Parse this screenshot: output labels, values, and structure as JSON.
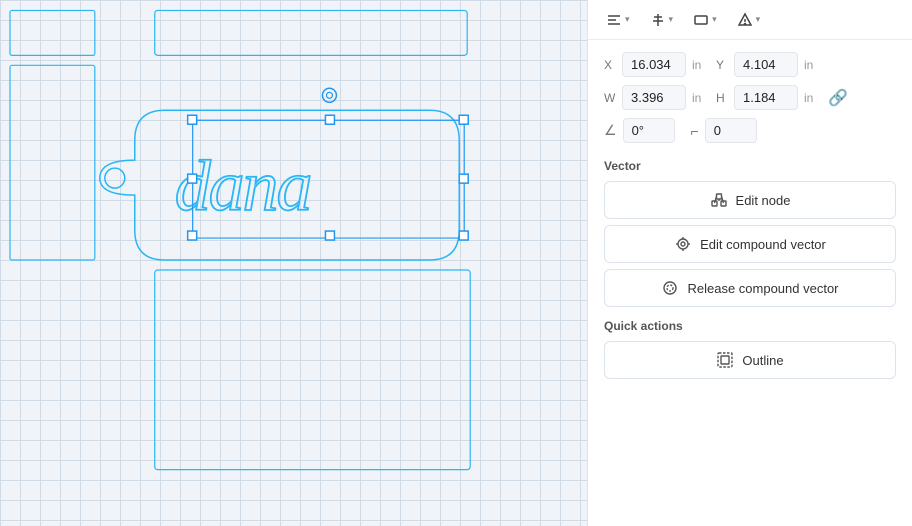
{
  "toolbar": {
    "btn1_label": "≡",
    "btn2_label": "≡",
    "btn3_label": "▦",
    "btn4_label": "⚠"
  },
  "properties": {
    "x_label": "X",
    "y_label": "Y",
    "w_label": "W",
    "h_label": "H",
    "x_value": "16.034",
    "y_value": "4.104",
    "w_value": "3.396",
    "h_value": "1.184",
    "unit": "in",
    "angle_value": "0°",
    "corner_value": "0"
  },
  "vector_section": {
    "label": "Vector",
    "edit_node_label": "Edit node",
    "edit_compound_label": "Edit compound vector",
    "release_compound_label": "Release compound vector"
  },
  "quick_actions": {
    "label": "Quick actions",
    "outline_label": "Outline"
  }
}
